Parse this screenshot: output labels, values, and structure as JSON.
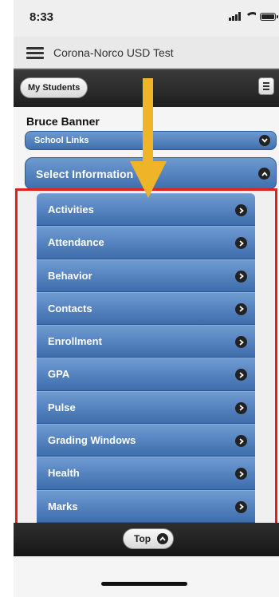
{
  "status_bar": {
    "time": "8:33"
  },
  "app": {
    "title": "Corona-Norco USD Test"
  },
  "toolbar": {
    "my_students_label": "My Students"
  },
  "student": {
    "name": "Bruce Banner"
  },
  "school_links": {
    "label": "School Links",
    "icon": "chevron-down-icon"
  },
  "select_information": {
    "label": "Select Information",
    "icon": "chevron-up-icon"
  },
  "menu_items": [
    {
      "label": "Activities",
      "icon": "chevron-right-icon"
    },
    {
      "label": "Attendance",
      "icon": "chevron-right-icon"
    },
    {
      "label": "Behavior",
      "icon": "chevron-right-icon"
    },
    {
      "label": "Contacts",
      "icon": "chevron-right-icon"
    },
    {
      "label": "Enrollment",
      "icon": "chevron-right-icon"
    },
    {
      "label": "GPA",
      "icon": "chevron-right-icon"
    },
    {
      "label": "Pulse",
      "icon": "chevron-right-icon"
    },
    {
      "label": "Grading Windows",
      "icon": "chevron-right-icon"
    },
    {
      "label": "Health",
      "icon": "chevron-right-icon"
    },
    {
      "label": "Marks",
      "icon": "chevron-right-icon"
    }
  ],
  "footer": {
    "top_label": "Top"
  },
  "colors": {
    "button_blue": "#4f7dbd",
    "highlight_red": "#e02020",
    "annotation_arrow": "#f0b429"
  }
}
